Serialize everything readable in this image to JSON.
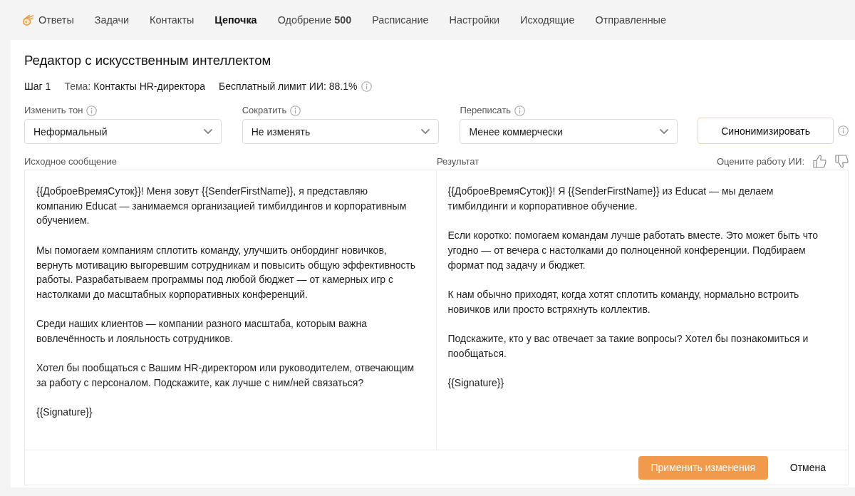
{
  "nav": {
    "items": [
      {
        "label": "Ответы",
        "selected": false
      },
      {
        "label": "Задачи",
        "selected": false
      },
      {
        "label": "Контакты",
        "selected": false
      },
      {
        "label": "Цепочка",
        "selected": true
      },
      {
        "label": "Одобрение **500**",
        "selected": false
      },
      {
        "label": "Расписание",
        "selected": false
      },
      {
        "label": "Настройки",
        "selected": false
      },
      {
        "label": "Исходящие",
        "selected": false
      },
      {
        "label": "Отправленные",
        "selected": false
      }
    ]
  },
  "editor": {
    "title": "Редактор с искусственным интеллектом",
    "step": "Шаг 1",
    "topic_label": "Тема:",
    "topic": "Контакты HR-директора",
    "limit": "Бесплатный лимит ИИ: 88.1%"
  },
  "controls": [
    {
      "label": "Изменить тон",
      "value": "Неформальный"
    },
    {
      "label": "Сократить",
      "value": "Не изменять"
    },
    {
      "label": "Переписать",
      "value": "Менее коммерчески"
    }
  ],
  "synonymize_button": "Синонимизировать",
  "source": {
    "label": "Исходное сообщение",
    "paragraphs": [
      "{{ДоброеВремяСуток}}! Меня зовут {{SenderFirstName}}, я представляю компанию Educat — занимаемся организацией тимбилдингов и корпоративным обучением.",
      "Мы помогаем компаниям сплотить команду, улучшить онбординг новичков, вернуть мотивацию выгоревшим сотрудникам и повысить общую эффективность работы. Разрабатываем программы под любой бюджет — от камерных игр с настолками до масштабных корпоративных конференций.",
      "Среди наших клиентов — компании разного масштаба, которым важна вовлечённость и лояльность сотрудников.",
      "Хотел бы пообщаться с Вашим HR-директором или руководителем, отвечающим за работу с персоналом. Подскажите, как лучше с ним/ней связаться?",
      "{{Signature}}"
    ]
  },
  "result": {
    "label": "Результат",
    "rating_prompt": "Оцените работу ИИ:",
    "paragraphs": [
      "{{ДоброеВремяСуток}}! Я {{SenderFirstName}} из Educat — мы делаем тимбилдинги и корпоративное обучение.",
      "Если коротко: помогаем командам лучше работать вместе. Это может быть что угодно — от вечера с настолками до полноценной конференции. Подбираем формат под задачу и бюджет.",
      "К нам обычно приходят, когда хотят сплотить команду, нормально встроить новичков или просто встряхнуть коллектив.",
      "Подскажите, кто у вас отвечает за такие вопросы? Хотел бы познакомиться и пообщаться.",
      "{{Signature}}"
    ]
  },
  "actions": {
    "apply": "Применить изменения",
    "cancel": "Отмена"
  }
}
